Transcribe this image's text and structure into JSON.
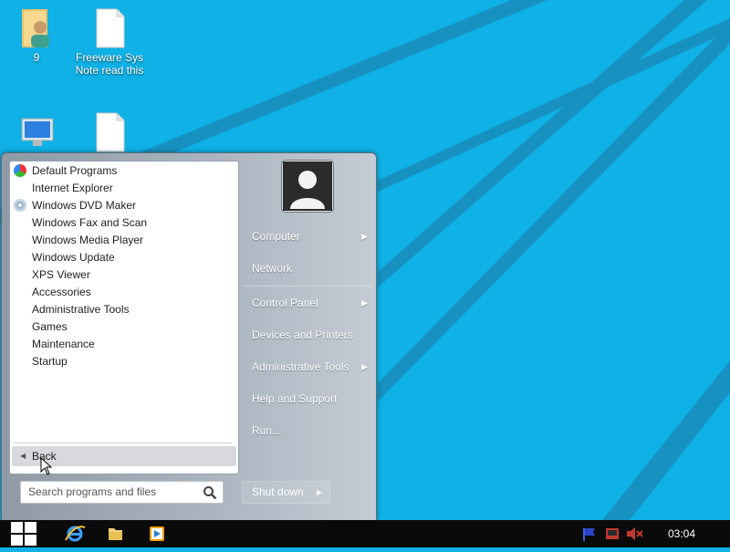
{
  "desktop": {
    "icons": [
      {
        "label": "9"
      },
      {
        "label": "Freeware Sys\nNote read this"
      }
    ]
  },
  "start_menu": {
    "programs": [
      {
        "label": "Default Programs",
        "icon": "default-programs-icon"
      },
      {
        "label": "Internet Explorer",
        "icon": "blank-icon"
      },
      {
        "label": "Windows DVD Maker",
        "icon": "dvd-icon"
      },
      {
        "label": "Windows Fax and Scan",
        "icon": "blank-icon"
      },
      {
        "label": "Windows Media Player",
        "icon": "blank-icon"
      },
      {
        "label": "Windows Update",
        "icon": "blank-icon"
      },
      {
        "label": "XPS Viewer",
        "icon": "blank-icon"
      },
      {
        "label": "Accessories",
        "icon": "blank-icon"
      },
      {
        "label": "Administrative Tools",
        "icon": "blank-icon"
      },
      {
        "label": "Games",
        "icon": "blank-icon"
      },
      {
        "label": "Maintenance",
        "icon": "blank-icon"
      },
      {
        "label": "Startup",
        "icon": "blank-icon"
      }
    ],
    "back_label": "Back",
    "search_placeholder": "Search programs and files",
    "right_items": [
      {
        "label": "Computer",
        "has_arrow": true
      },
      {
        "label": "Network",
        "has_arrow": false
      },
      {
        "label": "Control Panel",
        "has_arrow": true
      },
      {
        "label": "Devices and Printers",
        "has_arrow": false
      },
      {
        "label": "Administrative Tools",
        "has_arrow": true
      },
      {
        "label": "Help and Support",
        "has_arrow": false
      },
      {
        "label": "Run...",
        "has_arrow": false
      }
    ],
    "shutdown_label": "Shut down"
  },
  "taskbar": {
    "clock": "03:04"
  },
  "colors": {
    "desktop_bg": "#0fb1e6",
    "desktop_lines": "#1a8fbf",
    "taskbar_bg": "#0a0a0a"
  }
}
